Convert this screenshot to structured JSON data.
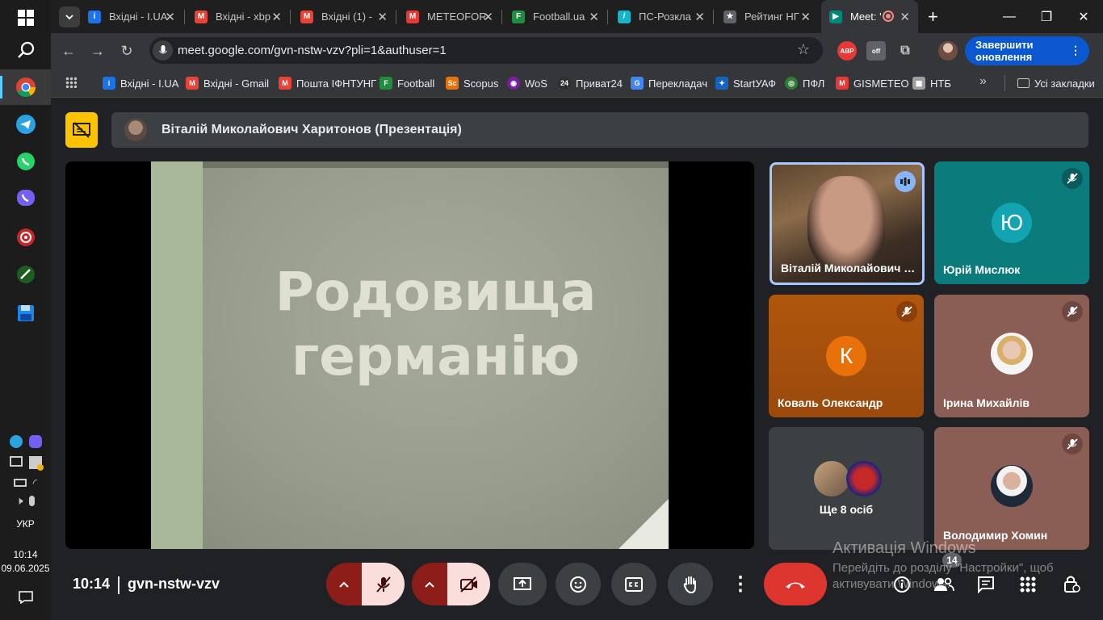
{
  "browser": {
    "tabs": [
      {
        "title": "Вхідні - I.UA",
        "icon": "iua-icon",
        "color": "#1a73e8",
        "glyph": "i"
      },
      {
        "title": "Вхідні - xbp",
        "icon": "gmail-icon",
        "color": "#ea4335",
        "glyph": "M"
      },
      {
        "title": "Вхідні (1) -",
        "icon": "gmail-icon",
        "color": "#ea4335",
        "glyph": "M"
      },
      {
        "title": "METEOFOR",
        "icon": "meteofor-icon",
        "color": "#e53935",
        "glyph": "M"
      },
      {
        "title": "Football.ua",
        "icon": "football-icon",
        "color": "#1e8e3e",
        "glyph": "F"
      },
      {
        "title": "ПС-Розкла",
        "icon": "schedule-icon",
        "color": "#12b5cb",
        "glyph": "/"
      },
      {
        "title": "Рейтинг НГ",
        "icon": "shield-icon",
        "color": "#5f6368",
        "glyph": "★"
      },
      {
        "title": "Meet: '",
        "icon": "meet-icon",
        "color": "#00897b",
        "glyph": "▶"
      }
    ],
    "url": "meet.google.com/gvn-nstw-vzv?pli=1&authuser=1",
    "update_label": "Завершити оновлення",
    "bookmarks": [
      {
        "label": "Вхідні - I.UA",
        "color": "#1a73e8",
        "glyph": "i"
      },
      {
        "label": "Вхідні - Gmail",
        "color": "#ea4335",
        "glyph": "M"
      },
      {
        "label": "Пошта ІФНТУНГ",
        "color": "#ea4335",
        "glyph": "M"
      },
      {
        "label": "Football",
        "color": "#1e8e3e",
        "glyph": "F"
      },
      {
        "label": "Scopus",
        "color": "#e8710a",
        "glyph": "Sc"
      },
      {
        "label": "WoS",
        "color": "#7b1fa2",
        "glyph": "◉"
      },
      {
        "label": "Приват24",
        "color": "#2e2e2e",
        "glyph": "24"
      },
      {
        "label": "Перекладач",
        "color": "#4285f4",
        "glyph": "G"
      },
      {
        "label": "StartУАФ",
        "color": "#1565c0",
        "glyph": "✦"
      },
      {
        "label": "ПФЛ",
        "color": "#2e7d32",
        "glyph": "◎"
      },
      {
        "label": "GISMETEO",
        "color": "#e53935",
        "glyph": "M"
      },
      {
        "label": "НТБ",
        "color": "#9e9e9e",
        "glyph": "▦"
      }
    ],
    "all_bookmarks_label": "Усі закладки"
  },
  "meet": {
    "presenter_label": "Віталій Миколайович Харитонов (Презентація)",
    "slide_title_line1": "Родовища",
    "slide_title_line2": "германію",
    "participants": [
      {
        "name": "Віталій Миколайович Х...",
        "type": "video",
        "speaking": true
      },
      {
        "name": "Юрій Мислюк",
        "type": "letter",
        "letter": "Ю",
        "bg": "#0b7b7b",
        "avatar_bg": "#12a4b0",
        "muted": true
      },
      {
        "name": "Коваль Олександр",
        "type": "letter",
        "letter": "К",
        "bg": "#b0560d",
        "avatar_bg": "#e8710a",
        "muted": true
      },
      {
        "name": "Ірина Михайлів",
        "type": "photo",
        "bg": "#8a5d55",
        "muted": true
      },
      {
        "name": "Ще 8 осіб",
        "type": "more",
        "bg": "#3c4043"
      },
      {
        "name": "Володимир Хомин",
        "type": "photo",
        "bg": "#8a5d55",
        "muted": true
      }
    ],
    "time": "10:14",
    "meeting_code": "gvn-nstw-vzv",
    "participants_count": "14"
  },
  "windows": {
    "language": "УКР",
    "time": "10:14",
    "date": "09.06.2025",
    "activation_title": "Активація Windows",
    "activation_text": "Перейдіть до розділу \"Настройки\", щоб активувати Windows."
  },
  "colors": {
    "accent_blue": "#0b57d0",
    "present_yellow": "#fdc200",
    "danger_red": "#ea4335",
    "muted_pink": "#f9dedc",
    "dark_red": "#8c1d18"
  }
}
